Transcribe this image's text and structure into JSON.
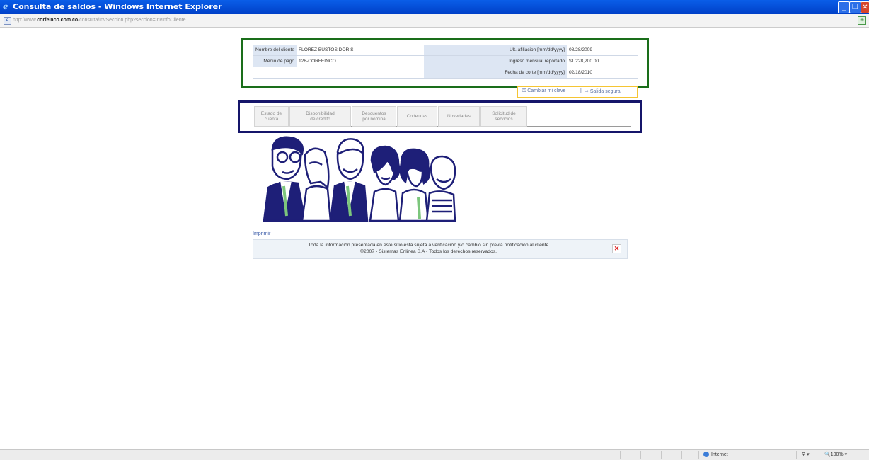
{
  "window": {
    "title": "Consulta de saldos - Windows Internet Explorer",
    "minimize_glyph": "_",
    "restore_glyph": "❐",
    "close_glyph": "✕"
  },
  "address_bar": {
    "url_prefix": "http://www.",
    "url_domain": "corfeinco.com.co",
    "url_path": "/consulta/InvSeccion.php?seccion=InvInfoCliente"
  },
  "client_info": {
    "name_label": "Nombre del cliente",
    "name_value": "FLOREZ BUSTOS DORIS",
    "payment_label": "Medio de pago",
    "payment_value": "128-CORFEINCO",
    "affiliation_label": "Ult. afiliacion [mm/dd/yyyy]",
    "affiliation_value": "08/28/2009",
    "income_label": "Ingreso mensual reportado",
    "income_value": "$1,228,200.00",
    "cutoff_label": "Fecha de corte [mm/dd/yyyy]",
    "cutoff_value": "02/18/2010"
  },
  "actions": {
    "change_password": "Cambiar mi clave",
    "separator": "|",
    "logout": "Salida segura"
  },
  "tabs": [
    {
      "line1": "Estado de",
      "line2": "cuenta"
    },
    {
      "line1": "Disponibilidad",
      "line2": "de credito"
    },
    {
      "line1": "Descuentos",
      "line2": "por nomina"
    },
    {
      "line1": "Codeudas",
      "line2": ""
    },
    {
      "line1": "Novedades",
      "line2": ""
    },
    {
      "line1": "Solicitud de",
      "line2": "servicios"
    }
  ],
  "footer": {
    "print_label": "Imprimir",
    "notice": "Toda la información presentada en este sitio esta sujeta a verificación y/o cambio sin previa notificacion al cliente",
    "copyright": "©2007 - Sistemas Enlinea S.A - Todos los derechos reservados.",
    "close_glyph": "✕"
  },
  "status_bar": {
    "zone": "Internet",
    "zoom": "100%",
    "zoom_arrow": "▾",
    "protected_glyph": "⚲ ▾"
  },
  "colors": {
    "info_border": "#1a6e1a",
    "actions_border": "#f5c533",
    "tabs_border": "#15156a",
    "illustration_ink": "#1e1f78"
  }
}
